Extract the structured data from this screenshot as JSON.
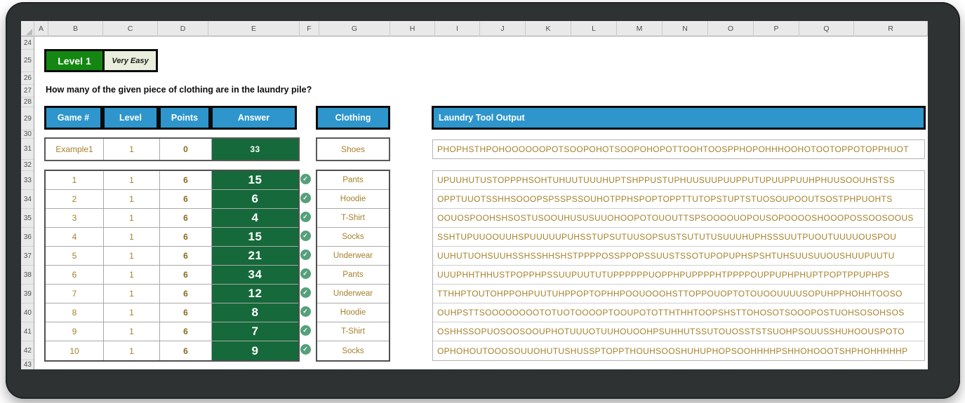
{
  "grid": {
    "columns": [
      "A",
      "B",
      "C",
      "D",
      "E",
      "F",
      "G",
      "H",
      "I",
      "J",
      "K",
      "L",
      "M",
      "N",
      "O",
      "P",
      "Q",
      "R"
    ],
    "rows": [
      "24",
      "25",
      "26",
      "27",
      "28",
      "29",
      "30",
      "31",
      "32",
      "33",
      "34",
      "35",
      "36",
      "37",
      "38",
      "39",
      "40",
      "41",
      "42",
      "43"
    ]
  },
  "level": {
    "badge": "Level 1",
    "difficulty": "Very Easy"
  },
  "question": "How many of the given piece of clothing are in the laundry pile?",
  "table": {
    "headers": {
      "game": "Game #",
      "level": "Level",
      "points": "Points",
      "answer": "Answer",
      "clothing": "Clothing",
      "output": "Laundry Tool Output"
    },
    "example": {
      "game": "Example1",
      "level": "1",
      "points": "0",
      "answer": "33",
      "clothing": "Shoes",
      "output": "PHOPHSTHPOHOOOOOOPOTSOOPOHOTSOOPOHOPOTTOOHTOOSPPHOPOHHHOOHOTOOTOPPOTOPPHUOT"
    },
    "rows": [
      {
        "game": "1",
        "level": "1",
        "points": "6",
        "answer": "15",
        "correct": true,
        "clothing": "Pants",
        "output": "UPUUHUTUSTOPPPHSOHTUHUUTUUUHUPTSHPPUSTUPHUUSUUPUUPPUTUPUUPPUUHPHUUSOOUHSTSS"
      },
      {
        "game": "2",
        "level": "1",
        "points": "6",
        "answer": "6",
        "correct": true,
        "clothing": "Hoodie",
        "output": "OPPTUUOTSSHHSOOOPSPSSPSSOUHOTPPHSPOPTOPPTTUTOPSTUPTSTUOSOUPOOUTSOSTPHPUOHTS"
      },
      {
        "game": "3",
        "level": "1",
        "points": "6",
        "answer": "4",
        "correct": true,
        "clothing": "T-Shirt",
        "output": "OOUOSPOOHSHSOSTUSOOUHUSUSUUOHOOPOTOUOUTTSPSOOOOUOPOUSOPOOOOSHOOOPOSSOOSOOUS"
      },
      {
        "game": "4",
        "level": "1",
        "points": "6",
        "answer": "15",
        "correct": true,
        "clothing": "Socks",
        "output": "SSHTUPUUOOUUHSPUUUUUPUHSSTUPSUTUUSOPSUSTSUTUTUSUUUHUPHSSSUUTPUOUTUUUUOUSPOU"
      },
      {
        "game": "5",
        "level": "1",
        "points": "6",
        "answer": "21",
        "correct": true,
        "clothing": "Underwear",
        "output": "UUHUTUOHSUUHSSHSSHHSHSTPPPPOSSPPOPSSUUSTSSOTUPOPUPHSPSHTUHSUUSUUOUSHUUPUUTU"
      },
      {
        "game": "6",
        "level": "1",
        "points": "6",
        "answer": "34",
        "correct": true,
        "clothing": "Pants",
        "output": "UUUPHHTHHUSTPOPPHPSSUUPUUTUTUPPPPPPUOPPHPUPPPPHTPPPPOUPPUPHPHUPTPOPTPPUPHPS"
      },
      {
        "game": "7",
        "level": "1",
        "points": "6",
        "answer": "12",
        "correct": true,
        "clothing": "Underwear",
        "output": "TTHHPTOUTOHPPOHPUUTUHPPOPTOPHHPOOUOOOHSTTOPPOUOPTOTOUOOUUUUSOPUHPPHOHHTOOSO"
      },
      {
        "game": "8",
        "level": "1",
        "points": "6",
        "answer": "8",
        "correct": true,
        "clothing": "Hoodie",
        "output": "OUHPSTTSOOOOOOOOTOTUOTOOOOPTOOUPOTOTTHTHHTOOPSHSTTOHOSOTSOOOPOSTUOHSOSOHSOS"
      },
      {
        "game": "9",
        "level": "1",
        "points": "6",
        "answer": "7",
        "correct": true,
        "clothing": "T-Shirt",
        "output": "OSHHSSOPUOSOOSOOUPHOTUUUOTUUHOUOOHPSUHHUTSSUTOUOSSTSTSUOHPSOUUSSHUHOOUSPOTO"
      },
      {
        "game": "10",
        "level": "1",
        "points": "6",
        "answer": "9",
        "correct": true,
        "clothing": "Socks",
        "output": "OPHOHOUTOOOSOUUOHUTUSHUSSPTOPPTHOUHSOOSHUHUPHOPSOOHHHHPSHHOHOOOTSHPHOHHHHHP"
      }
    ]
  },
  "icons": {
    "check_glyph": "✓"
  },
  "colors": {
    "frame": "#2e3232",
    "header_blue": "#2e96cc",
    "border_black": "#0a0a0a",
    "answer_green": "#15693a",
    "badge_green": "#148712",
    "badge_light_bg": "#e9efdc",
    "gold": "#a5802b",
    "gold_dark": "#8a6a1d",
    "check_green": "#55a07a",
    "grid_header_bg": "#e9e9e9",
    "grid_header_text": "#4f4f4f"
  }
}
